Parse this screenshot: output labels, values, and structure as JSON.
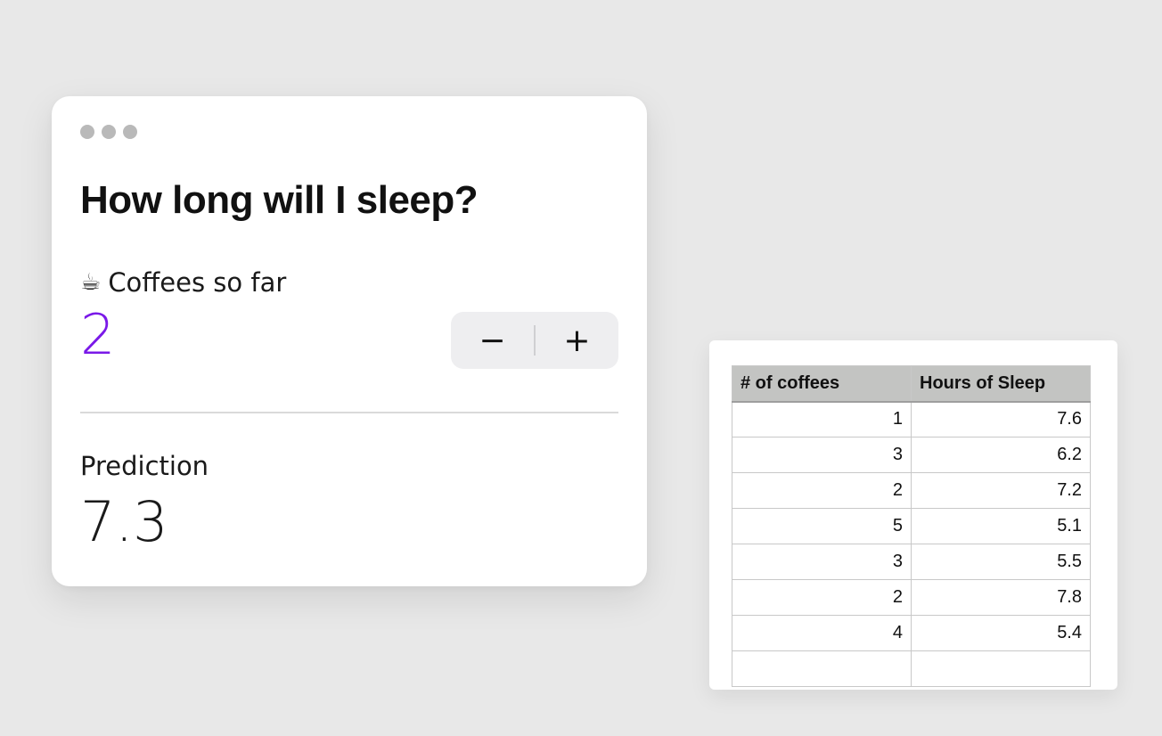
{
  "widget": {
    "title": "How long will I sleep?",
    "coffee_icon": "coffee-cup-icon",
    "coffee_glyph": "☕",
    "coffee_label": "Coffees so far",
    "coffee_value": "2",
    "decrement_label": "−",
    "increment_label": "+",
    "prediction_label": "Prediction",
    "prediction_value": "7.3",
    "accent_color": "#7a19e8"
  },
  "sheet": {
    "headers": [
      "# of coffees",
      "Hours of Sleep"
    ],
    "rows": [
      [
        "1",
        "7.6"
      ],
      [
        "3",
        "6.2"
      ],
      [
        "2",
        "7.2"
      ],
      [
        "5",
        "5.1"
      ],
      [
        "3",
        "5.5"
      ],
      [
        "2",
        "7.8"
      ],
      [
        "4",
        "5.4"
      ],
      [
        "",
        ""
      ]
    ]
  }
}
